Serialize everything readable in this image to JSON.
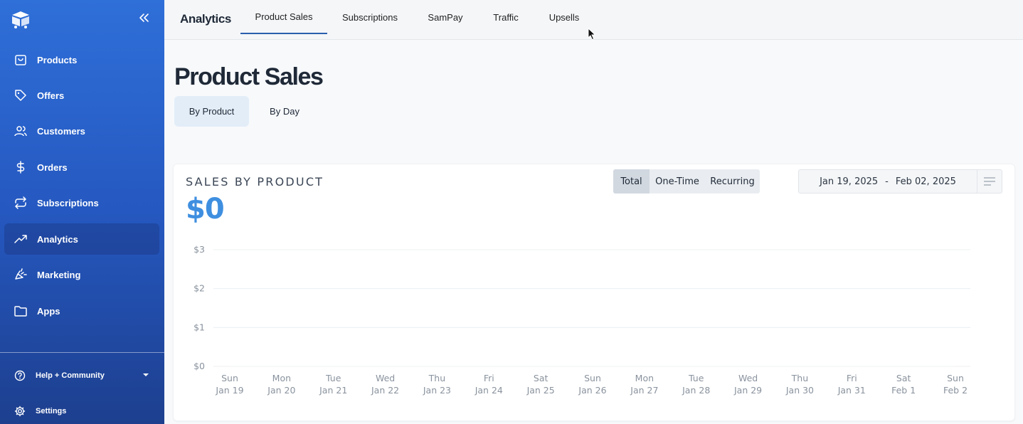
{
  "sidebar": {
    "collapse_icon": "double-chevron-left-icon",
    "items": [
      {
        "label": "Products",
        "icon": "shopping-bag-icon"
      },
      {
        "label": "Offers",
        "icon": "tag-icon"
      },
      {
        "label": "Customers",
        "icon": "users-icon"
      },
      {
        "label": "Orders",
        "icon": "dollar-icon"
      },
      {
        "label": "Subscriptions",
        "icon": "repeat-icon"
      },
      {
        "label": "Analytics",
        "icon": "trending-up-icon",
        "active": true
      },
      {
        "label": "Marketing",
        "icon": "megaphone-icon"
      },
      {
        "label": "Apps",
        "icon": "folder-icon"
      }
    ],
    "help": {
      "label": "Help + Community",
      "icon": "help-circle-icon"
    },
    "settings": {
      "label": "Settings",
      "icon": "gear-icon"
    }
  },
  "topbar": {
    "section": "Analytics",
    "tabs": [
      {
        "label": "Product Sales",
        "active": true
      },
      {
        "label": "Subscriptions"
      },
      {
        "label": "SamPay"
      },
      {
        "label": "Traffic"
      },
      {
        "label": "Upsells"
      }
    ]
  },
  "page": {
    "title": "Product Sales",
    "views": [
      {
        "label": "By Product",
        "active": true
      },
      {
        "label": "By Day"
      }
    ]
  },
  "card": {
    "title": "SALES BY PRODUCT",
    "total": "$0",
    "segments": [
      {
        "label": "Total",
        "active": true
      },
      {
        "label": "One-Time"
      },
      {
        "label": "Recurring"
      }
    ],
    "date_start": "Jan 19, 2025",
    "date_sep": "-",
    "date_end": "Feb 02, 2025"
  },
  "colors": {
    "accent": "#3f8fe0",
    "sidebar_top": "#2f6fd8",
    "sidebar_bottom": "#1d3f8e",
    "tab_underline": "#2a5fae"
  },
  "chart_data": {
    "type": "line",
    "title": "SALES BY PRODUCT",
    "categories": [
      [
        "Sun",
        "Jan 19"
      ],
      [
        "Mon",
        "Jan 20"
      ],
      [
        "Tue",
        "Jan 21"
      ],
      [
        "Wed",
        "Jan 22"
      ],
      [
        "Thu",
        "Jan 23"
      ],
      [
        "Fri",
        "Jan 24"
      ],
      [
        "Sat",
        "Jan 25"
      ],
      [
        "Sun",
        "Jan 26"
      ],
      [
        "Mon",
        "Jan 27"
      ],
      [
        "Tue",
        "Jan 28"
      ],
      [
        "Wed",
        "Jan 29"
      ],
      [
        "Thu",
        "Jan 30"
      ],
      [
        "Fri",
        "Jan 31"
      ],
      [
        "Sat",
        "Feb 1"
      ],
      [
        "Sun",
        "Feb 2"
      ]
    ],
    "values": [
      0,
      0,
      0,
      0,
      0,
      0,
      0,
      0,
      0,
      0,
      0,
      0,
      0,
      0,
      0
    ],
    "y_ticks": [
      "$0",
      "$1",
      "$2",
      "$3"
    ],
    "ylim": [
      0,
      3
    ],
    "grid": true
  }
}
